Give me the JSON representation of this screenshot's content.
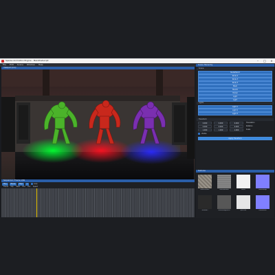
{
  "window": {
    "title": "Sparse Animation Engine - MainPostscript"
  },
  "menu": [
    "File",
    "Edit",
    "Scene",
    "Window",
    "Help"
  ],
  "viewport_panel": {
    "title": "Viewport (0.1)"
  },
  "scene_hierarchy": {
    "title": "Scene Hierarchy",
    "section": "Scene",
    "items": [
      "NodeMain3",
      "Node 2",
      "Node 3",
      "Node 4",
      "Mesh",
      "Mesh2",
      "Model",
      "Light",
      "Light"
    ],
    "lights_section": "Lights",
    "lights": [
      "Light 1",
      "Light 2",
      "Light 3"
    ]
  },
  "transform": {
    "section": "Transform",
    "rows": [
      {
        "values": [
          "0.000",
          "0.000",
          "0.000"
        ],
        "label": "Translation"
      },
      {
        "values": [
          "0.000",
          "0.000",
          "0.000"
        ],
        "label": "Rotation"
      },
      {
        "values": [
          "1.000",
          "1.000",
          "1.000"
        ],
        "label": "Scale"
      }
    ],
    "check_label": "Visible",
    "apply_button": "Apply Transform"
  },
  "sequencer": {
    "title": "Sequencer / Frame 1/50",
    "buttons": [
      "Play",
      "Pause",
      "Stop",
      "+"
    ],
    "check_label": "Loop",
    "columns": [
      "Frame",
      "Clip",
      "Start",
      "End",
      "Dur",
      "Speed"
    ],
    "current_frame_fraction": 0.18
  },
  "textures": {
    "title": "Textures",
    "items": [
      {
        "name": "stoneDiffuse",
        "kind": "stone"
      },
      {
        "name": "stoneNormal",
        "kind": "gray"
      },
      {
        "name": "white",
        "kind": "white"
      },
      {
        "name": "normalMap",
        "kind": "normal"
      },
      {
        "name": "stoneAO",
        "kind": "dark"
      },
      {
        "name": "stoneRoughness",
        "kind": "gray2"
      },
      {
        "name": "specular",
        "kind": "white2"
      },
      {
        "name": "flatNormal",
        "kind": "normal2"
      }
    ]
  },
  "colors": {
    "accent": "#2f6fbd",
    "header": "#2a5ea8",
    "playhead": "#e8c200"
  }
}
